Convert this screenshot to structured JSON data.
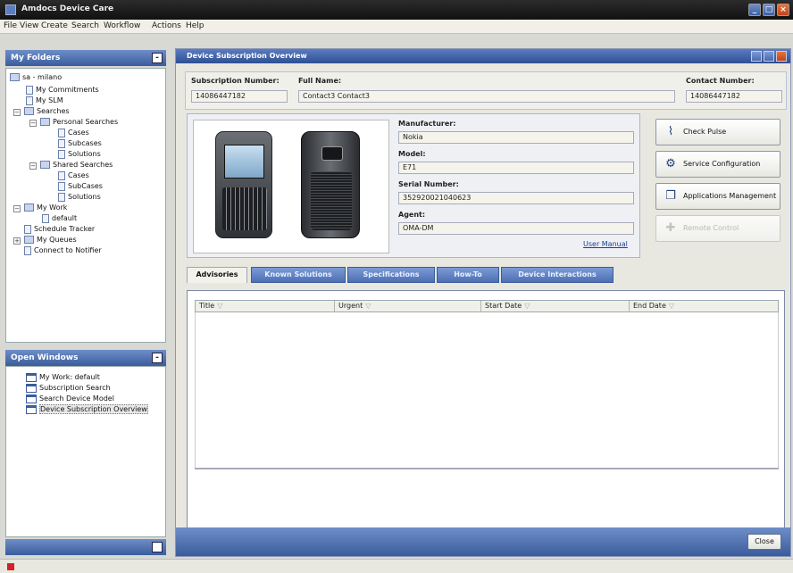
{
  "app": {
    "title": "Amdocs Device Care"
  },
  "menu": [
    "File",
    "View",
    "Create",
    "Search",
    "Workflow",
    "Actions",
    "Help"
  ],
  "my_folders": {
    "title": "My Folders",
    "toggle": "-",
    "items": [
      "sa - milano",
      "My Commitments",
      "My SLM",
      "Searches",
      "Personal Searches",
      "Cases",
      "Subcases",
      "Solutions",
      "Shared Searches",
      "Cases",
      "SubCases",
      "Solutions",
      "My Work",
      "default",
      "Schedule Tracker",
      "My Queues",
      "Connect to Notifier"
    ]
  },
  "open_windows": {
    "title": "Open Windows",
    "toggle": "-",
    "items": [
      "My Work: default",
      "Subscription Search",
      "Search Device Model",
      "Device Subscription Overview"
    ]
  },
  "main": {
    "title": "Device Subscription Overview",
    "subscription_number_label": "Subscription Number:",
    "subscription_number": "14086447182",
    "full_name_label": "Full Name:",
    "full_name": "Contact3 Contact3",
    "contact_number_label": "Contact Number:",
    "contact_number": "14086447182",
    "manufacturer_label": "Manufacturer:",
    "manufacturer": "Nokia",
    "model_label": "Model:",
    "model": "E71",
    "serial_label": "Serial Number:",
    "serial": "352920021040623",
    "agent_label": "Agent:",
    "agent": "OMA-DM",
    "user_manual": "User Manual",
    "actions": [
      {
        "label": "Check Pulse",
        "icon": "pulse-icon",
        "enabled": true
      },
      {
        "label": "Service Configuration",
        "icon": "gear-icon",
        "enabled": true
      },
      {
        "label": "Applications Management",
        "icon": "windows-icon",
        "enabled": true
      },
      {
        "label": "Remote Control",
        "icon": "cross-arrows-icon",
        "enabled": false
      }
    ],
    "tabs": [
      "Advisories",
      "Known Solutions",
      "Specifications",
      "How-To",
      "Device Interactions"
    ],
    "grid_columns": [
      "Title",
      "Urgent",
      "Start Date",
      "End Date"
    ],
    "close_label": "Close"
  },
  "colors": {
    "accent": "#3b5c9c",
    "titlebar": "#1a1a1a",
    "close": "#c2431a"
  }
}
